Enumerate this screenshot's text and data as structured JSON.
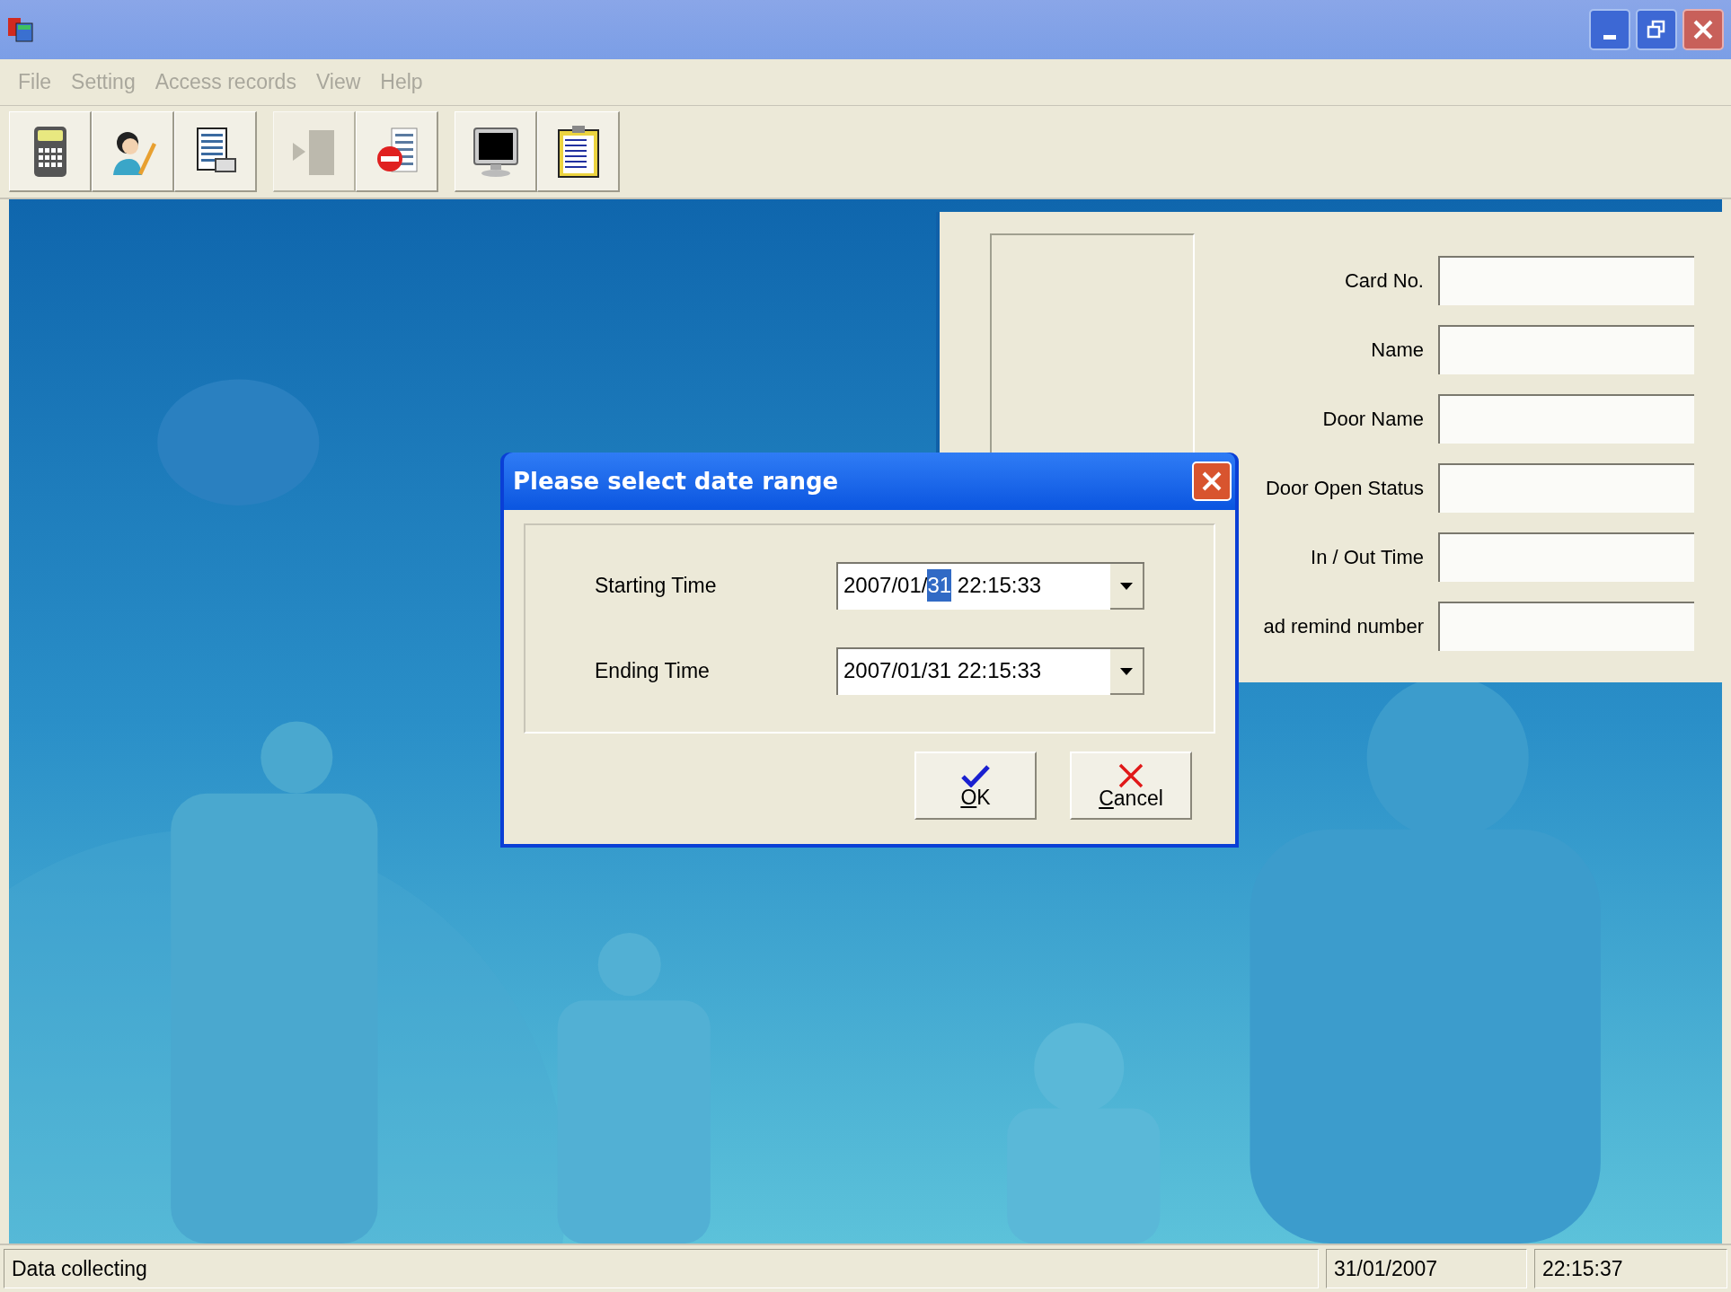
{
  "menu": [
    "File",
    "Setting",
    "Access records",
    "View",
    "Help"
  ],
  "toolbar_groups": [
    [
      {
        "kind": "terminal",
        "disabled": false
      },
      {
        "kind": "person",
        "disabled": false
      },
      {
        "kind": "document",
        "disabled": false
      }
    ],
    [
      {
        "kind": "enter",
        "disabled": true
      },
      {
        "kind": "stop",
        "disabled": false
      }
    ],
    [
      {
        "kind": "monitor",
        "disabled": false
      },
      {
        "kind": "clipboard",
        "disabled": false
      }
    ]
  ],
  "record_panel": {
    "fields": [
      {
        "label": "Card No."
      },
      {
        "label": "Name"
      },
      {
        "label": "Door Name"
      },
      {
        "label": "Door Open Status"
      },
      {
        "label": "In / Out Time"
      },
      {
        "label": "ad remind number"
      }
    ]
  },
  "dialog": {
    "title": "Please select date range",
    "fields": [
      {
        "label": "Starting Time",
        "segments": [
          {
            "text": "2007/01/",
            "selected": false
          },
          {
            "text": "31",
            "selected": true
          },
          {
            "text": " 22:15:33",
            "selected": false
          }
        ]
      },
      {
        "label": "Ending Time",
        "segments": [
          {
            "text": "2007/01/31 22:15:33",
            "selected": false
          }
        ]
      }
    ],
    "buttons": [
      {
        "kind": "ok",
        "label": "OK"
      },
      {
        "kind": "cancel",
        "label": "Cancel"
      }
    ]
  },
  "status_bar": [
    "Data collecting",
    "31/01/2007",
    "22:15:37"
  ]
}
